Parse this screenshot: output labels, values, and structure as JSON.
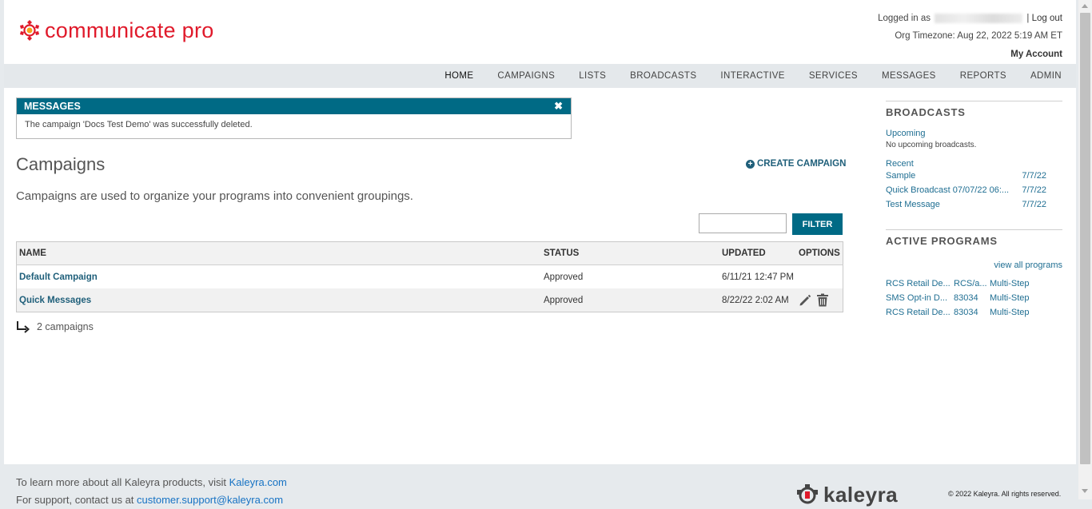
{
  "brand": {
    "logo_text": "communicate pro",
    "accent": "#e01a2b",
    "primary": "#006a85"
  },
  "header": {
    "logged_in_prefix": "Logged in as",
    "logout_sep": "|",
    "logout": "Log out",
    "timezone": "Org Timezone: Aug 22, 2022 5:19 AM ET",
    "my_account": "My Account"
  },
  "nav": {
    "items": [
      "HOME",
      "CAMPAIGNS",
      "LISTS",
      "BROADCASTS",
      "INTERACTIVE",
      "SERVICES",
      "MESSAGES",
      "REPORTS",
      "ADMIN"
    ],
    "active": "HOME"
  },
  "messages": {
    "title": "MESSAGES",
    "close": "✖",
    "text": "The campaign 'Docs Test Demo' was successfully deleted."
  },
  "main": {
    "title": "Campaigns",
    "create_label": "CREATE CAMPAIGN",
    "description": "Campaigns are used to organize your programs into convenient groupings.",
    "filter_label": "FILTER",
    "filter_value": ""
  },
  "table": {
    "headers": {
      "name": "NAME",
      "status": "STATUS",
      "updated": "UPDATED",
      "options": "OPTIONS"
    },
    "rows": [
      {
        "name": "Default Campaign",
        "status": "Approved",
        "updated": "6/11/21 12:47 PM"
      },
      {
        "name": "Quick Messages",
        "status": "Approved",
        "updated": "8/22/22 2:02 AM"
      }
    ],
    "count": "2 campaigns"
  },
  "sidebar": {
    "broadcasts": {
      "title": "BROADCASTS",
      "upcoming_label": "Upcoming",
      "upcoming_none": "No upcoming broadcasts.",
      "recent_label": "Recent",
      "recent": [
        {
          "name": "Sample",
          "date": "7/7/22"
        },
        {
          "name": "Quick Broadcast 07/07/22 06:...",
          "date": "7/7/22"
        },
        {
          "name": "Test Message",
          "date": "7/7/22"
        }
      ]
    },
    "programs": {
      "title": "ACTIVE PROGRAMS",
      "view_all": "view all programs",
      "items": [
        {
          "name": "RCS Retail De...",
          "code": "RCS/a...",
          "type": "Multi-Step"
        },
        {
          "name": "SMS Opt-in D...",
          "code": "83034",
          "type": "Multi-Step"
        },
        {
          "name": "RCS Retail De...",
          "code": "83034",
          "type": "Multi-Step"
        }
      ]
    }
  },
  "footer": {
    "learn_prefix": "To learn more about all Kaleyra products, visit",
    "learn_link": "Kaleyra.com",
    "support_prefix": "For support, contact us at",
    "support_link": "customer.support@kaleyra.com",
    "logo_text": "kaleyra",
    "copyright": "© 2022 Kaleyra. All rights reserved."
  }
}
